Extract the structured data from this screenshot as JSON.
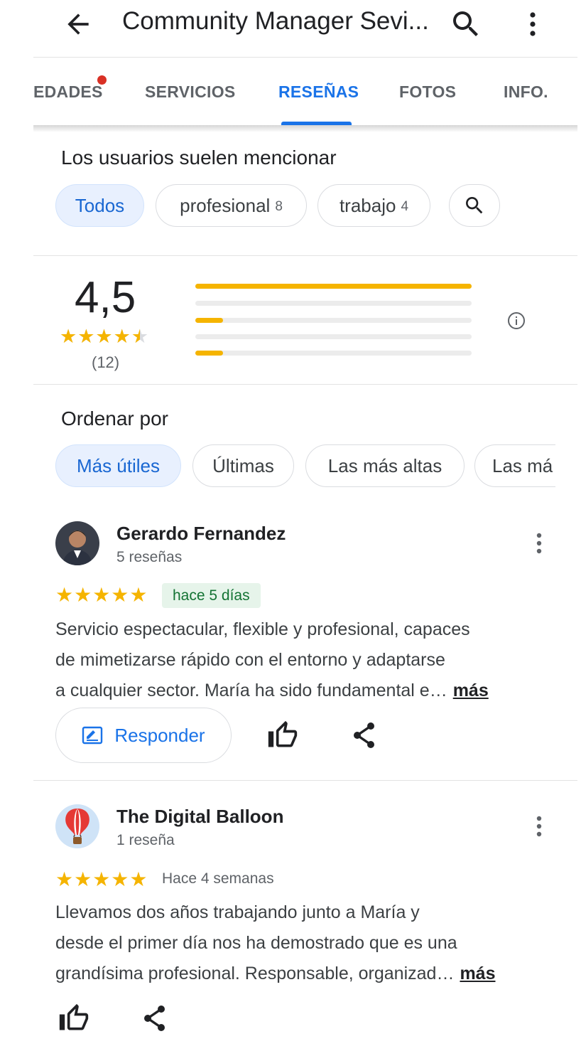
{
  "header": {
    "title": "Community Manager Sevi...",
    "back_icon": "arrow-back-icon",
    "search_icon": "search-icon",
    "more_icon": "more-vert-icon"
  },
  "tabs": [
    {
      "label": "EDADES",
      "active": false,
      "has_dot": true
    },
    {
      "label": "SERVICIOS",
      "active": false
    },
    {
      "label": "RESEÑAS",
      "active": true
    },
    {
      "label": "FOTOS",
      "active": false
    },
    {
      "label": "INFO.",
      "active": false
    }
  ],
  "mentions": {
    "title": "Los usuarios suelen mencionar",
    "chips": [
      {
        "label": "Todos",
        "count": "",
        "selected": true
      },
      {
        "label": "profesional",
        "count": "8",
        "selected": false
      },
      {
        "label": "trabajo",
        "count": "4",
        "selected": false
      }
    ],
    "search_icon": "search-icon"
  },
  "rating": {
    "value": "4,5",
    "stars_display": "★★★★★",
    "star_fraction": 0.9,
    "count": "(12)",
    "distribution": [
      {
        "stars": 5,
        "fraction": 1.0
      },
      {
        "stars": 4,
        "fraction": 0.0
      },
      {
        "stars": 3,
        "fraction": 0.1
      },
      {
        "stars": 2,
        "fraction": 0.0
      },
      {
        "stars": 1,
        "fraction": 0.1
      }
    ],
    "info_icon": "info-icon"
  },
  "sort": {
    "title": "Ordenar por",
    "chips": [
      {
        "label": "Más útiles",
        "selected": true
      },
      {
        "label": "Últimas",
        "selected": false
      },
      {
        "label": "Las más altas",
        "selected": false
      },
      {
        "label": "Las má",
        "selected": false
      }
    ]
  },
  "reviews": [
    {
      "name": "Gerardo Fernandez",
      "meta": "5 reseñas",
      "stars": "★★★★★",
      "date": "hace 5 días",
      "is_new": true,
      "text_lines": [
        "Servicio espectacular, flexible y profesional, capaces",
        "de mimetizarse rápido con el entorno y adaptarse",
        "a cualquier sector. María ha sido fundamental e…"
      ],
      "more": "más",
      "reply_label": "Responder",
      "avatar_icon": "person-avatar"
    },
    {
      "name": "The Digital Balloon",
      "meta": "1 reseña",
      "stars": "★★★★★",
      "date": "Hace 4 semanas",
      "is_new": false,
      "text_lines": [
        "Llevamos dos años trabajando junto a María y",
        "desde el primer día nos ha demostrado que es una",
        "grandísima profesional. Responsable, organizad…"
      ],
      "more": "más",
      "avatar_icon": "hot-air-balloon-avatar"
    }
  ],
  "colors": {
    "accent": "#1a73e8",
    "star": "#f5b400",
    "new_badge_bg": "#e6f4ea",
    "new_badge_text": "#137333",
    "notification_dot": "#d93025"
  }
}
